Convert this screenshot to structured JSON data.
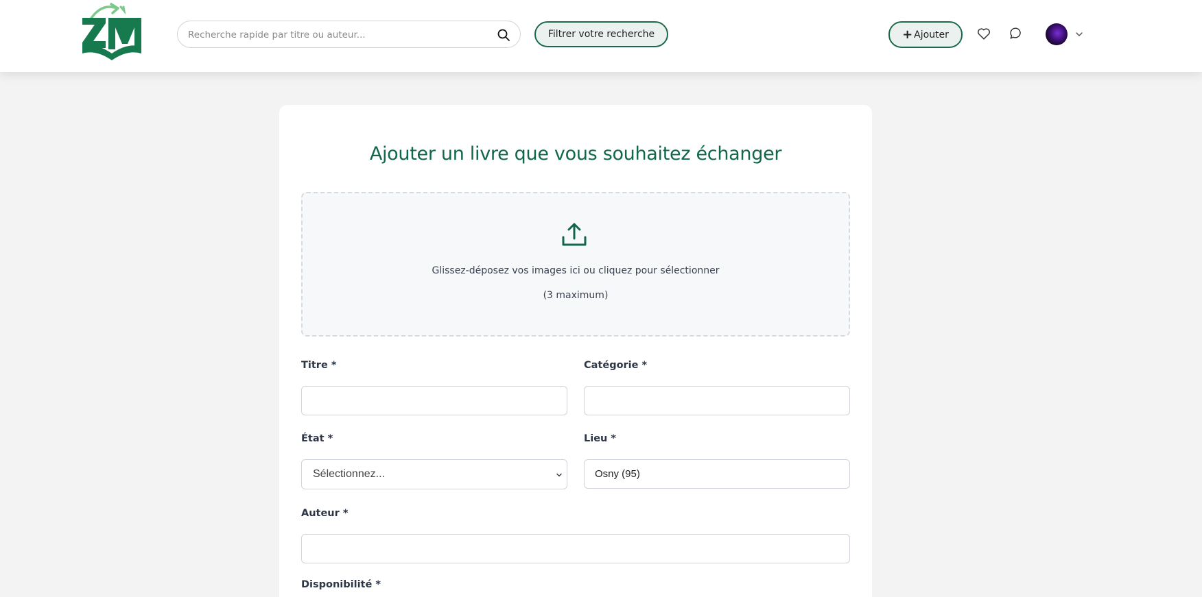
{
  "header": {
    "logo_text": "ZM",
    "search": {
      "placeholder": "Recherche rapide par titre ou auteur...",
      "value": ""
    },
    "filter_label": "Filtrer votre recherche",
    "add_label": "Ajouter",
    "add_icon": "+"
  },
  "form": {
    "title": "Ajouter un livre que vous souhaitez échanger",
    "dropzone": {
      "text": "Glissez-déposez vos images ici ou cliquez pour sélectionner",
      "subtext": "(3 maximum)"
    },
    "fields": {
      "titre": {
        "label": "Titre *",
        "value": ""
      },
      "categorie": {
        "label": "Catégorie *",
        "value": ""
      },
      "etat": {
        "label": "État *",
        "selected": "Sélectionnez..."
      },
      "lieu": {
        "label": "Lieu *",
        "value": "Osny (95)"
      },
      "auteur": {
        "label": "Auteur *",
        "value": ""
      },
      "disponibilite": {
        "label": "Disponibilité *"
      }
    }
  },
  "colors": {
    "brand_green": "#10674a",
    "button_border": "#1a6a4a",
    "button_bg": "#eaf1ee",
    "page_bg": "#f3f3f3"
  }
}
